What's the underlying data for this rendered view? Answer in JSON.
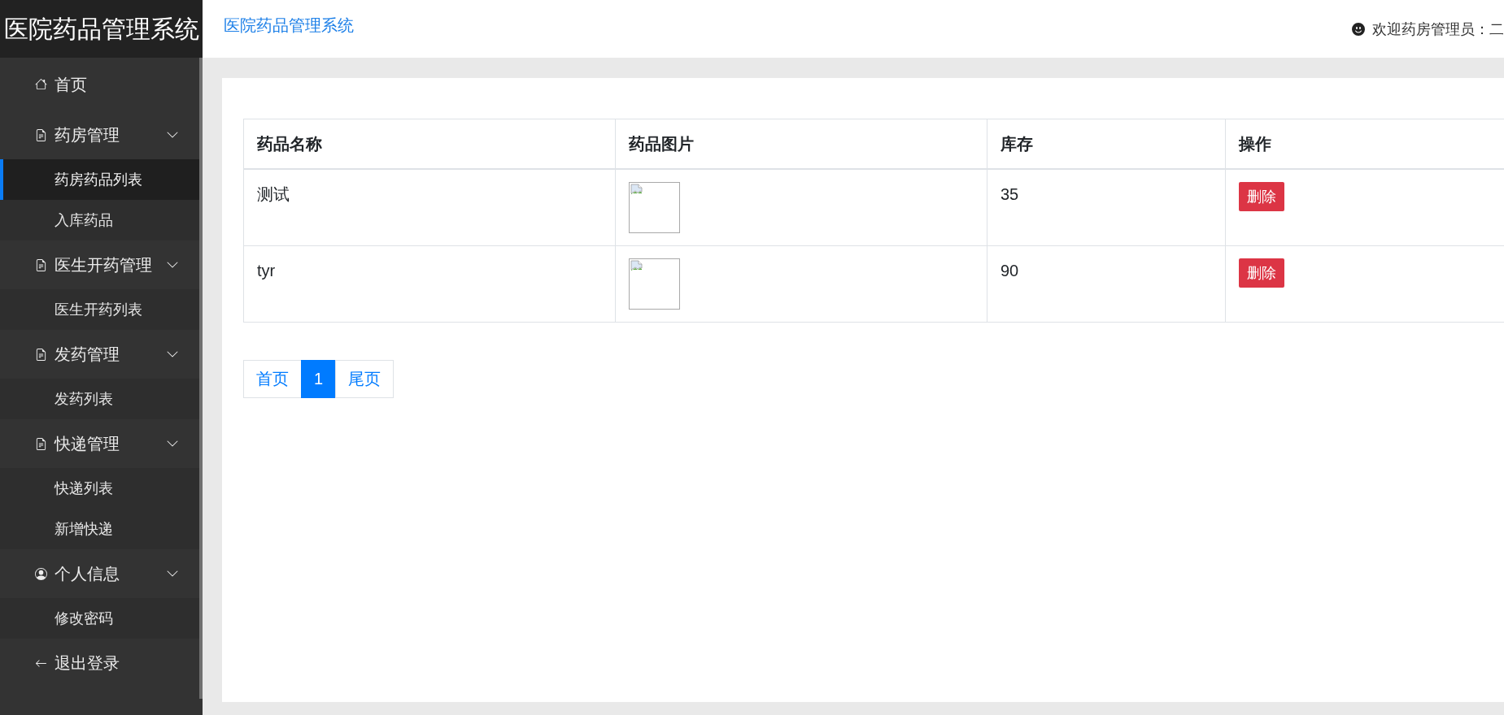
{
  "sidebar": {
    "brand": "医院药品管理系统",
    "items": [
      {
        "kind": "home",
        "label": "首页"
      },
      {
        "kind": "group",
        "label": "药房管理",
        "expanded": true,
        "children": [
          {
            "label": "药房药品列表",
            "selected": true
          },
          {
            "label": "入库药品",
            "selected": false
          }
        ]
      },
      {
        "kind": "group",
        "label": "医生开药管理",
        "expanded": true,
        "children": [
          {
            "label": "医生开药列表",
            "selected": false
          }
        ]
      },
      {
        "kind": "group",
        "label": "发药管理",
        "expanded": true,
        "children": [
          {
            "label": "发药列表",
            "selected": false
          }
        ]
      },
      {
        "kind": "group",
        "label": "快递管理",
        "expanded": true,
        "children": [
          {
            "label": "快递列表",
            "selected": false
          },
          {
            "label": "新增快递",
            "selected": false
          }
        ]
      },
      {
        "kind": "profile",
        "label": "个人信息",
        "expanded": true,
        "children": [
          {
            "label": "修改密码",
            "selected": false
          }
        ]
      },
      {
        "kind": "logout",
        "label": "退出登录"
      }
    ]
  },
  "header": {
    "title": "医院药品管理系统",
    "welcome": "欢迎药房管理员：二"
  },
  "table": {
    "columns": [
      "药品名称",
      "药品图片",
      "库存",
      "操作"
    ],
    "rows": [
      {
        "name": "测试",
        "stock": "35",
        "action": "删除"
      },
      {
        "name": "tyr",
        "stock": "90",
        "action": "删除"
      }
    ]
  },
  "pagination": [
    {
      "label": "首页",
      "selected": false
    },
    {
      "label": "1",
      "selected": true
    },
    {
      "label": "尾页",
      "selected": false
    }
  ]
}
